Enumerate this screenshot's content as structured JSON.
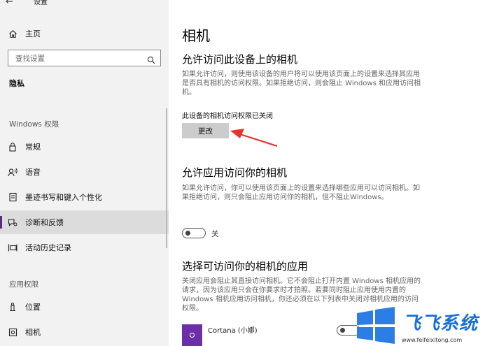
{
  "window": {
    "back_glyph": "←",
    "title": "设置"
  },
  "sidebar": {
    "home": "主页",
    "search_placeholder": "查找设置",
    "privacy_header": "隐私",
    "windows_permissions_caption": "Windows 权限",
    "items": [
      {
        "label": "常规",
        "icon": "lock-icon"
      },
      {
        "label": "语音",
        "icon": "speech-icon"
      },
      {
        "label": "墨迹书写和键入个性化",
        "icon": "ink-icon"
      },
      {
        "label": "诊断和反馈",
        "icon": "diagnostics-icon",
        "selected": true
      },
      {
        "label": "活动历史记录",
        "icon": "activity-history-icon"
      }
    ],
    "app_permissions_caption": "应用权限",
    "app_items": [
      {
        "label": "位置",
        "icon": "location-icon"
      },
      {
        "label": "相机",
        "icon": "camera-icon"
      }
    ]
  },
  "main": {
    "title": "相机",
    "section1": {
      "heading": "允许访问此设备上的相机",
      "description": "如果允许访问，则使用该设备的用户将可以使用该页面上的设置来选择其应用是否具有相机的访问权限。如果拒绝访问，则会阻止 Windows 和应用访问相机。",
      "status": "此设备的相机访问权限已关闭",
      "button_label": "更改"
    },
    "section2": {
      "heading": "允许应用访问你的相机",
      "description": "如果允许访问，你可以使用该页面上的设置来选择哪些应用可以访问相机。如果拒绝访问，则只会阻止应用访问你的相机，但不阻止Windows。",
      "toggle_label": "关",
      "toggle_on": false
    },
    "section3": {
      "heading": "选择可访问你的相机的应用",
      "description": "关闭应用会阻止其直接访问相机。它不会阻止打开内置 Windows 相机应用的请求，因为该应用只会在你要求时才拍照。若要同时阻止应用使用内置的 Windows 相机应用访问相机，你还必须在以下列表中关闭对相机应用的访问权限。",
      "apps": [
        {
          "name": "Cortana (小娜)",
          "on": false
        }
      ]
    }
  },
  "watermark": {
    "text": "飞飞系统",
    "url": "www.feifeixitong.com"
  },
  "colors": {
    "accent": "#5b2c83",
    "annotation_arrow": "#e8332a",
    "watermark_blue": "#1a6fd6"
  }
}
